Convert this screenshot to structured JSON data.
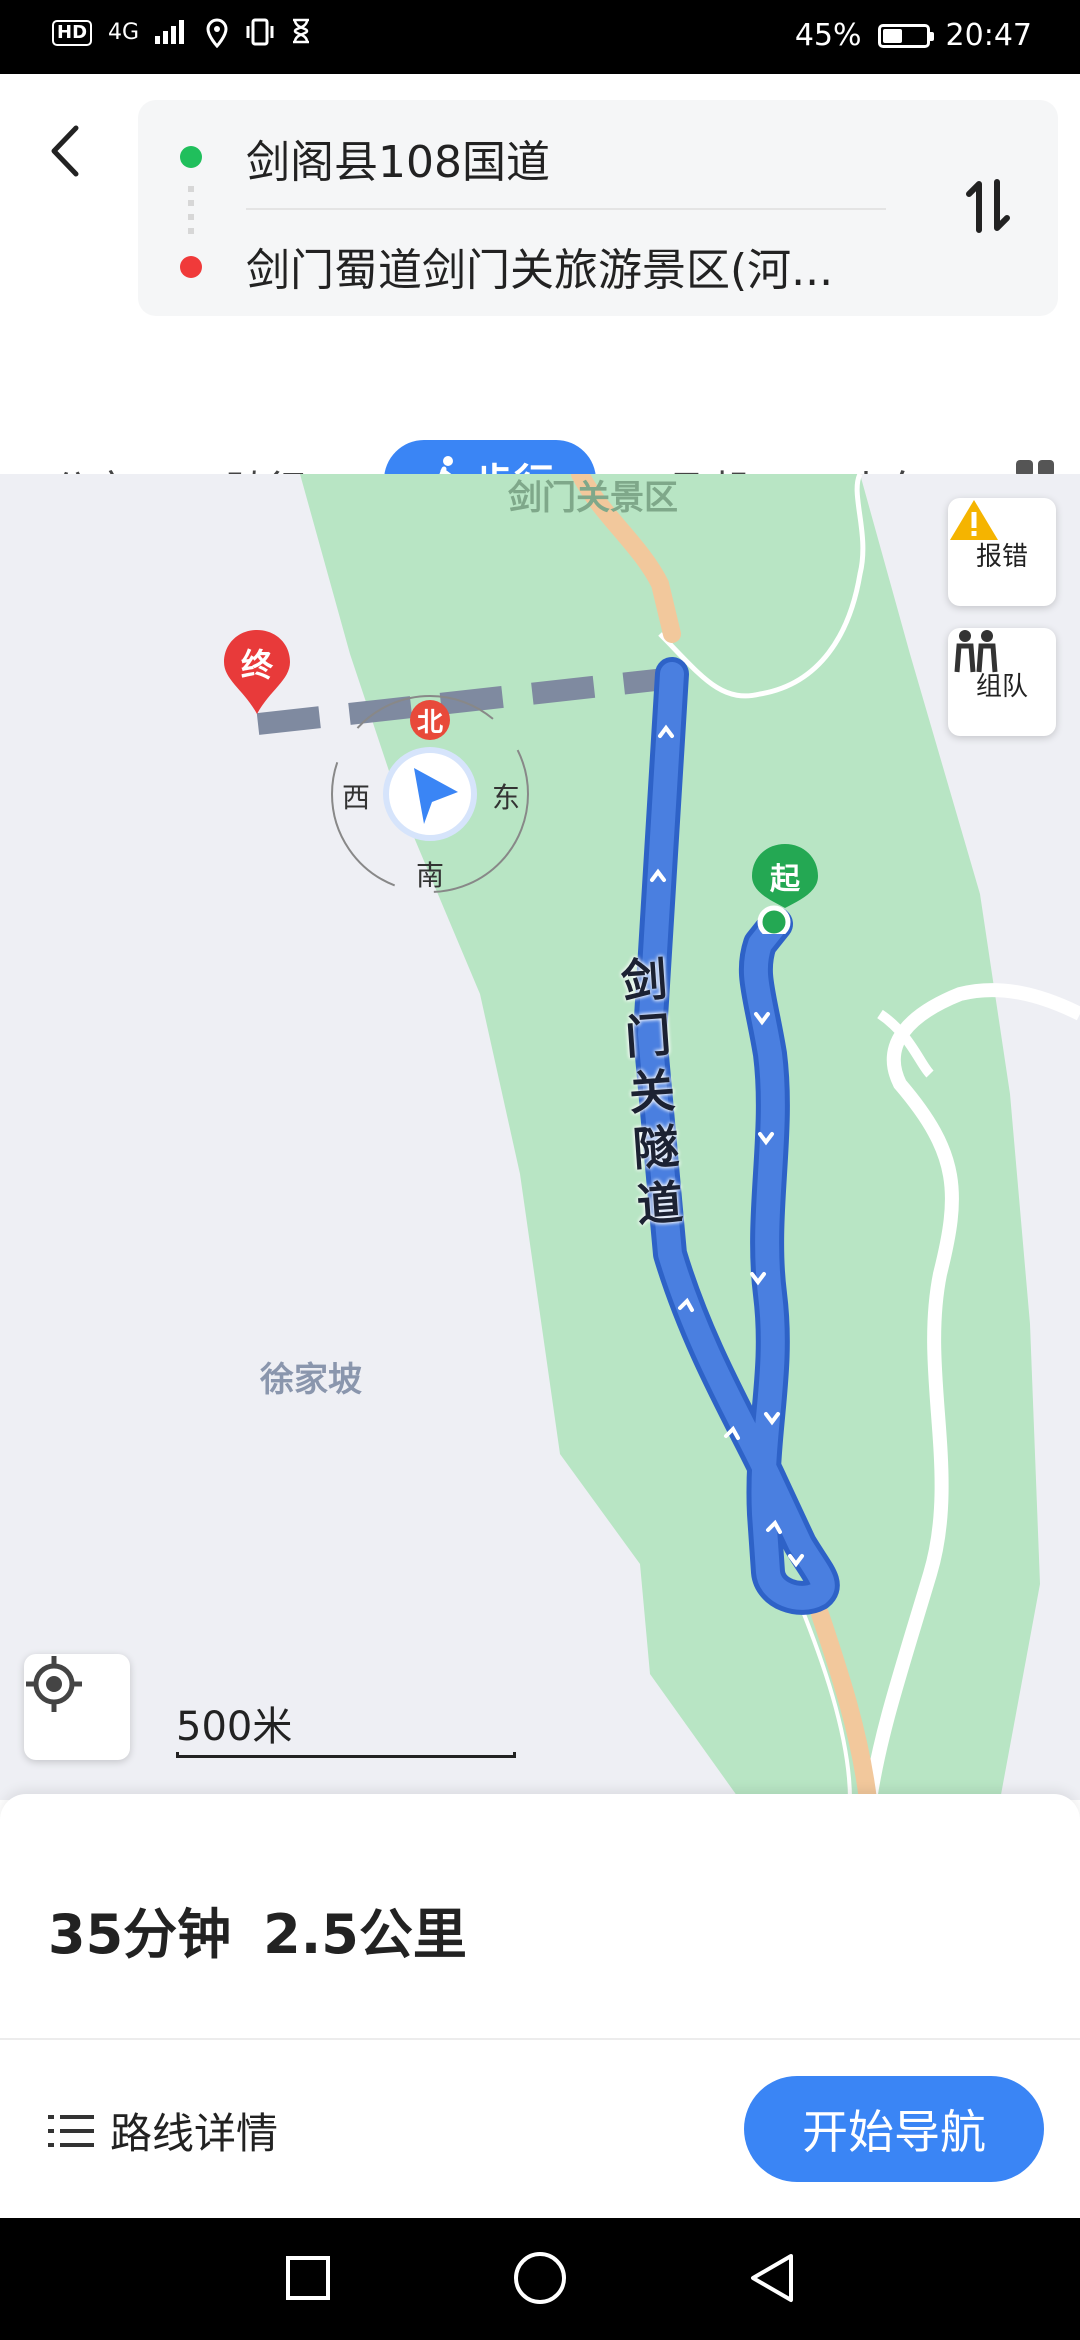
{
  "status_bar": {
    "hd": "HD",
    "network": "4G",
    "battery_percent": "45%",
    "battery_level": 0.45,
    "time": "20:47"
  },
  "route": {
    "from": "剑阁县108国道",
    "to": "剑门蜀道剑门关旅游景区(河..."
  },
  "tabs": [
    {
      "label": "公交"
    },
    {
      "label": "骑行"
    },
    {
      "label": "步行",
      "active": true
    },
    {
      "label": "飞机"
    },
    {
      "label": "火车"
    }
  ],
  "map": {
    "place_labels": {
      "scenic_area": "剑门关景区",
      "village": "徐家坡"
    },
    "road_label": [
      "剑",
      "门",
      "关",
      "隧",
      "道"
    ],
    "compass": {
      "north": "北",
      "south": "南",
      "east": "东",
      "west": "西"
    },
    "markers": {
      "start": "起",
      "end": "终"
    },
    "side_buttons": {
      "report": "报错",
      "team": "组队"
    },
    "scale": "500米"
  },
  "summary": {
    "duration": "35分钟",
    "distance": "2.5公里"
  },
  "actions": {
    "details": "路线详情",
    "start_nav": "开始导航"
  },
  "colors": {
    "accent": "#3a85f5",
    "route": "#4a7fe0",
    "park": "#b8e5c4",
    "start": "#24a853",
    "end": "#e83a3a"
  }
}
